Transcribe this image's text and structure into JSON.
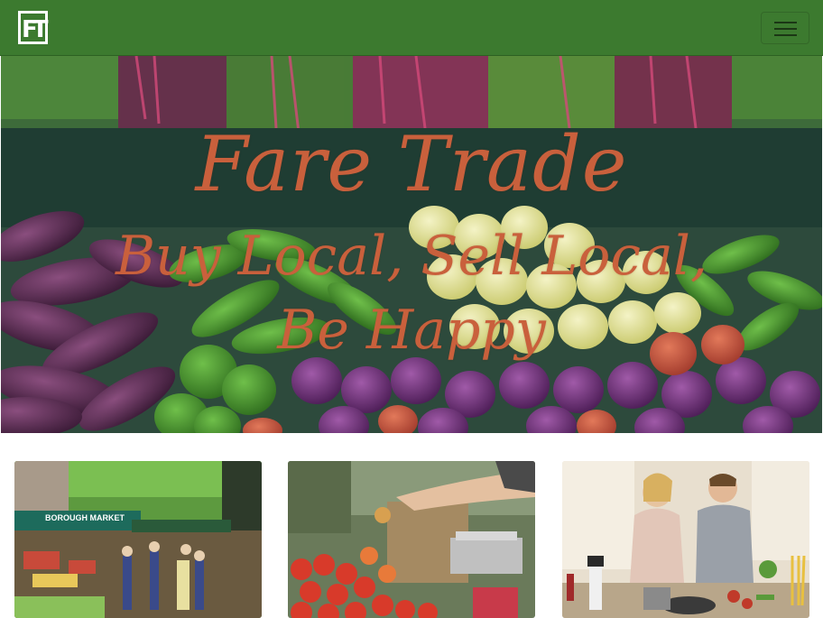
{
  "navbar": {
    "logo_text": "FT",
    "toggler_icon": "hamburger-icon",
    "background_color": "#3c7a2f"
  },
  "hero": {
    "title": "Fare Trade",
    "tagline_line1": "Buy Local, Sell Local,",
    "tagline_line2": "Be Happy",
    "accent_color": "#c9603c",
    "image": "vegetable-market-stall-photo"
  },
  "cards": [
    {
      "image": "borough-market-photo",
      "sign_text": "BOROUGH MARKET"
    },
    {
      "image": "produce-handoff-photo"
    },
    {
      "image": "couple-cooking-photo"
    }
  ]
}
